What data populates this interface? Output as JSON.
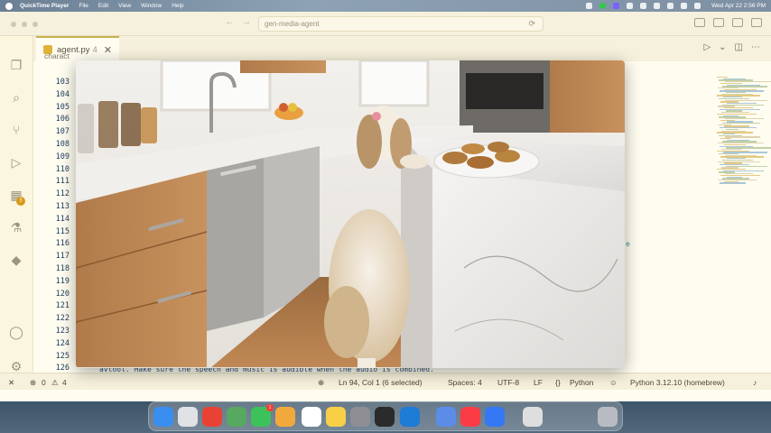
{
  "menubar": {
    "app_name": "QuickTime Player",
    "menus": [
      "File",
      "Edit",
      "View",
      "Window",
      "Help"
    ],
    "clock": "Wed Apr 22  2:56 PM"
  },
  "editor": {
    "command_center": "gen-media-agent",
    "tab": {
      "filename": "agent.py",
      "problems_count": "4"
    },
    "breadcrumb": "charact",
    "line_numbers": [
      "103",
      "104",
      "105",
      "106",
      "107",
      "108",
      "109",
      "110",
      "111",
      "112",
      "113",
      "114",
      "115",
      "116",
      "117",
      "118",
      "119",
      "120",
      "121",
      "122",
      "123",
      "124",
      "125",
      "126"
    ],
    "code_tail": "avtool. Make sure the speech and music is audible when the audio is combined.",
    "code_fragment_e": "e"
  },
  "statusbar": {
    "errors": "0",
    "warnings": "4",
    "cursor": "Ln 94, Col 1 (6 selected)",
    "spaces": "Spaces: 4",
    "encoding": "UTF-8",
    "eol": "LF",
    "language": "Python",
    "interpreter": "Python 3.12.10 (homebrew)"
  },
  "dock": {
    "apps": [
      "finder-icon",
      "launchpad-icon",
      "chrome-icon",
      "preview-icon",
      "messages-icon",
      "photos-icon",
      "reminders-icon",
      "notes-icon",
      "settings-icon",
      "terminal-icon",
      "vscode-icon",
      "gemini-icon",
      "music-icon",
      "quicktime-icon",
      "downloads-icon",
      "trash-icon"
    ],
    "messages_badge": "1"
  },
  "video": {
    "description_icon": "video-frame"
  },
  "colors": {
    "editor_bg": "#fffdf0",
    "accent": "#c9b050",
    "line_number": "#1d3a5c"
  }
}
